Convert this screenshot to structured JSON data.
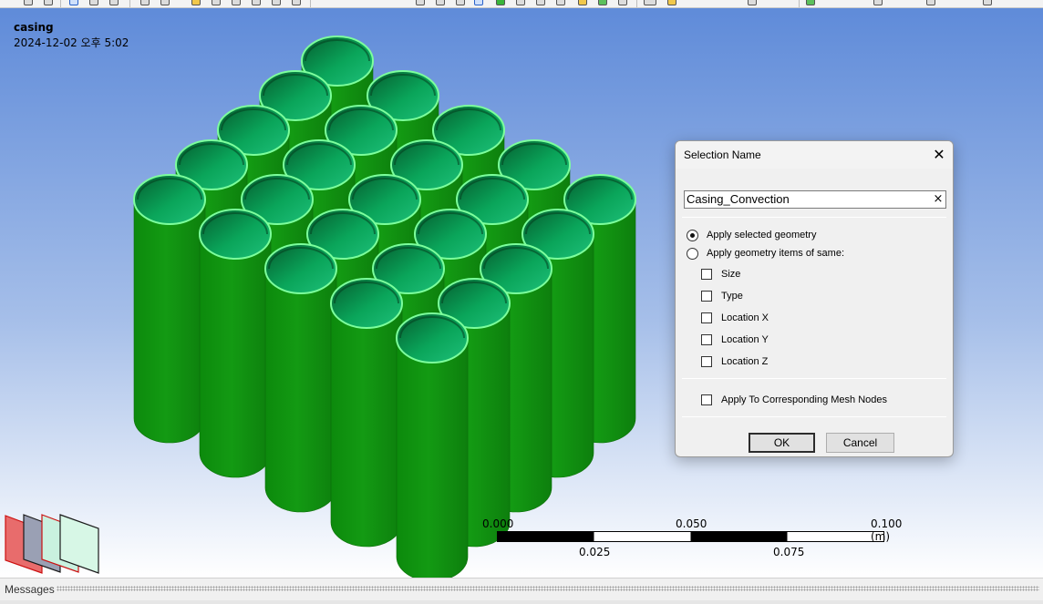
{
  "viewport": {
    "model_name": "casing",
    "timestamp": "2024-12-02 오후 5:02",
    "body_color": "#139a13",
    "top_face_color": "#0aa55a",
    "edge_highlight_color": "#7cff9c",
    "background_top": "#5f8bd9",
    "background_bottom": "#ffffff"
  },
  "scale_bar": {
    "top_labels": [
      "0.000",
      "0.050",
      "0.100 (m)"
    ],
    "bottom_labels": [
      "0.025",
      "0.075"
    ]
  },
  "dialog": {
    "title": "Selection Name",
    "name_value": "Casing_Convection",
    "clear_icon": "×",
    "close_icon": "✕",
    "radio_options": [
      {
        "label": "Apply selected geometry",
        "selected": true
      },
      {
        "label": "Apply geometry items of same:",
        "selected": false
      }
    ],
    "criteria": [
      {
        "label": "Size",
        "checked": false
      },
      {
        "label": "Type",
        "checked": false
      },
      {
        "label": "Location X",
        "checked": false
      },
      {
        "label": "Location Y",
        "checked": false
      },
      {
        "label": "Location Z",
        "checked": false
      }
    ],
    "mesh_nodes_option": {
      "label": "Apply To Corresponding Mesh Nodes",
      "checked": false
    },
    "ok_label": "OK",
    "cancel_label": "Cancel"
  },
  "messages": {
    "label": "Messages"
  },
  "icons": [
    "view-toolbar-icons",
    "close-icon",
    "clear-text-icon",
    "triad-icon"
  ]
}
